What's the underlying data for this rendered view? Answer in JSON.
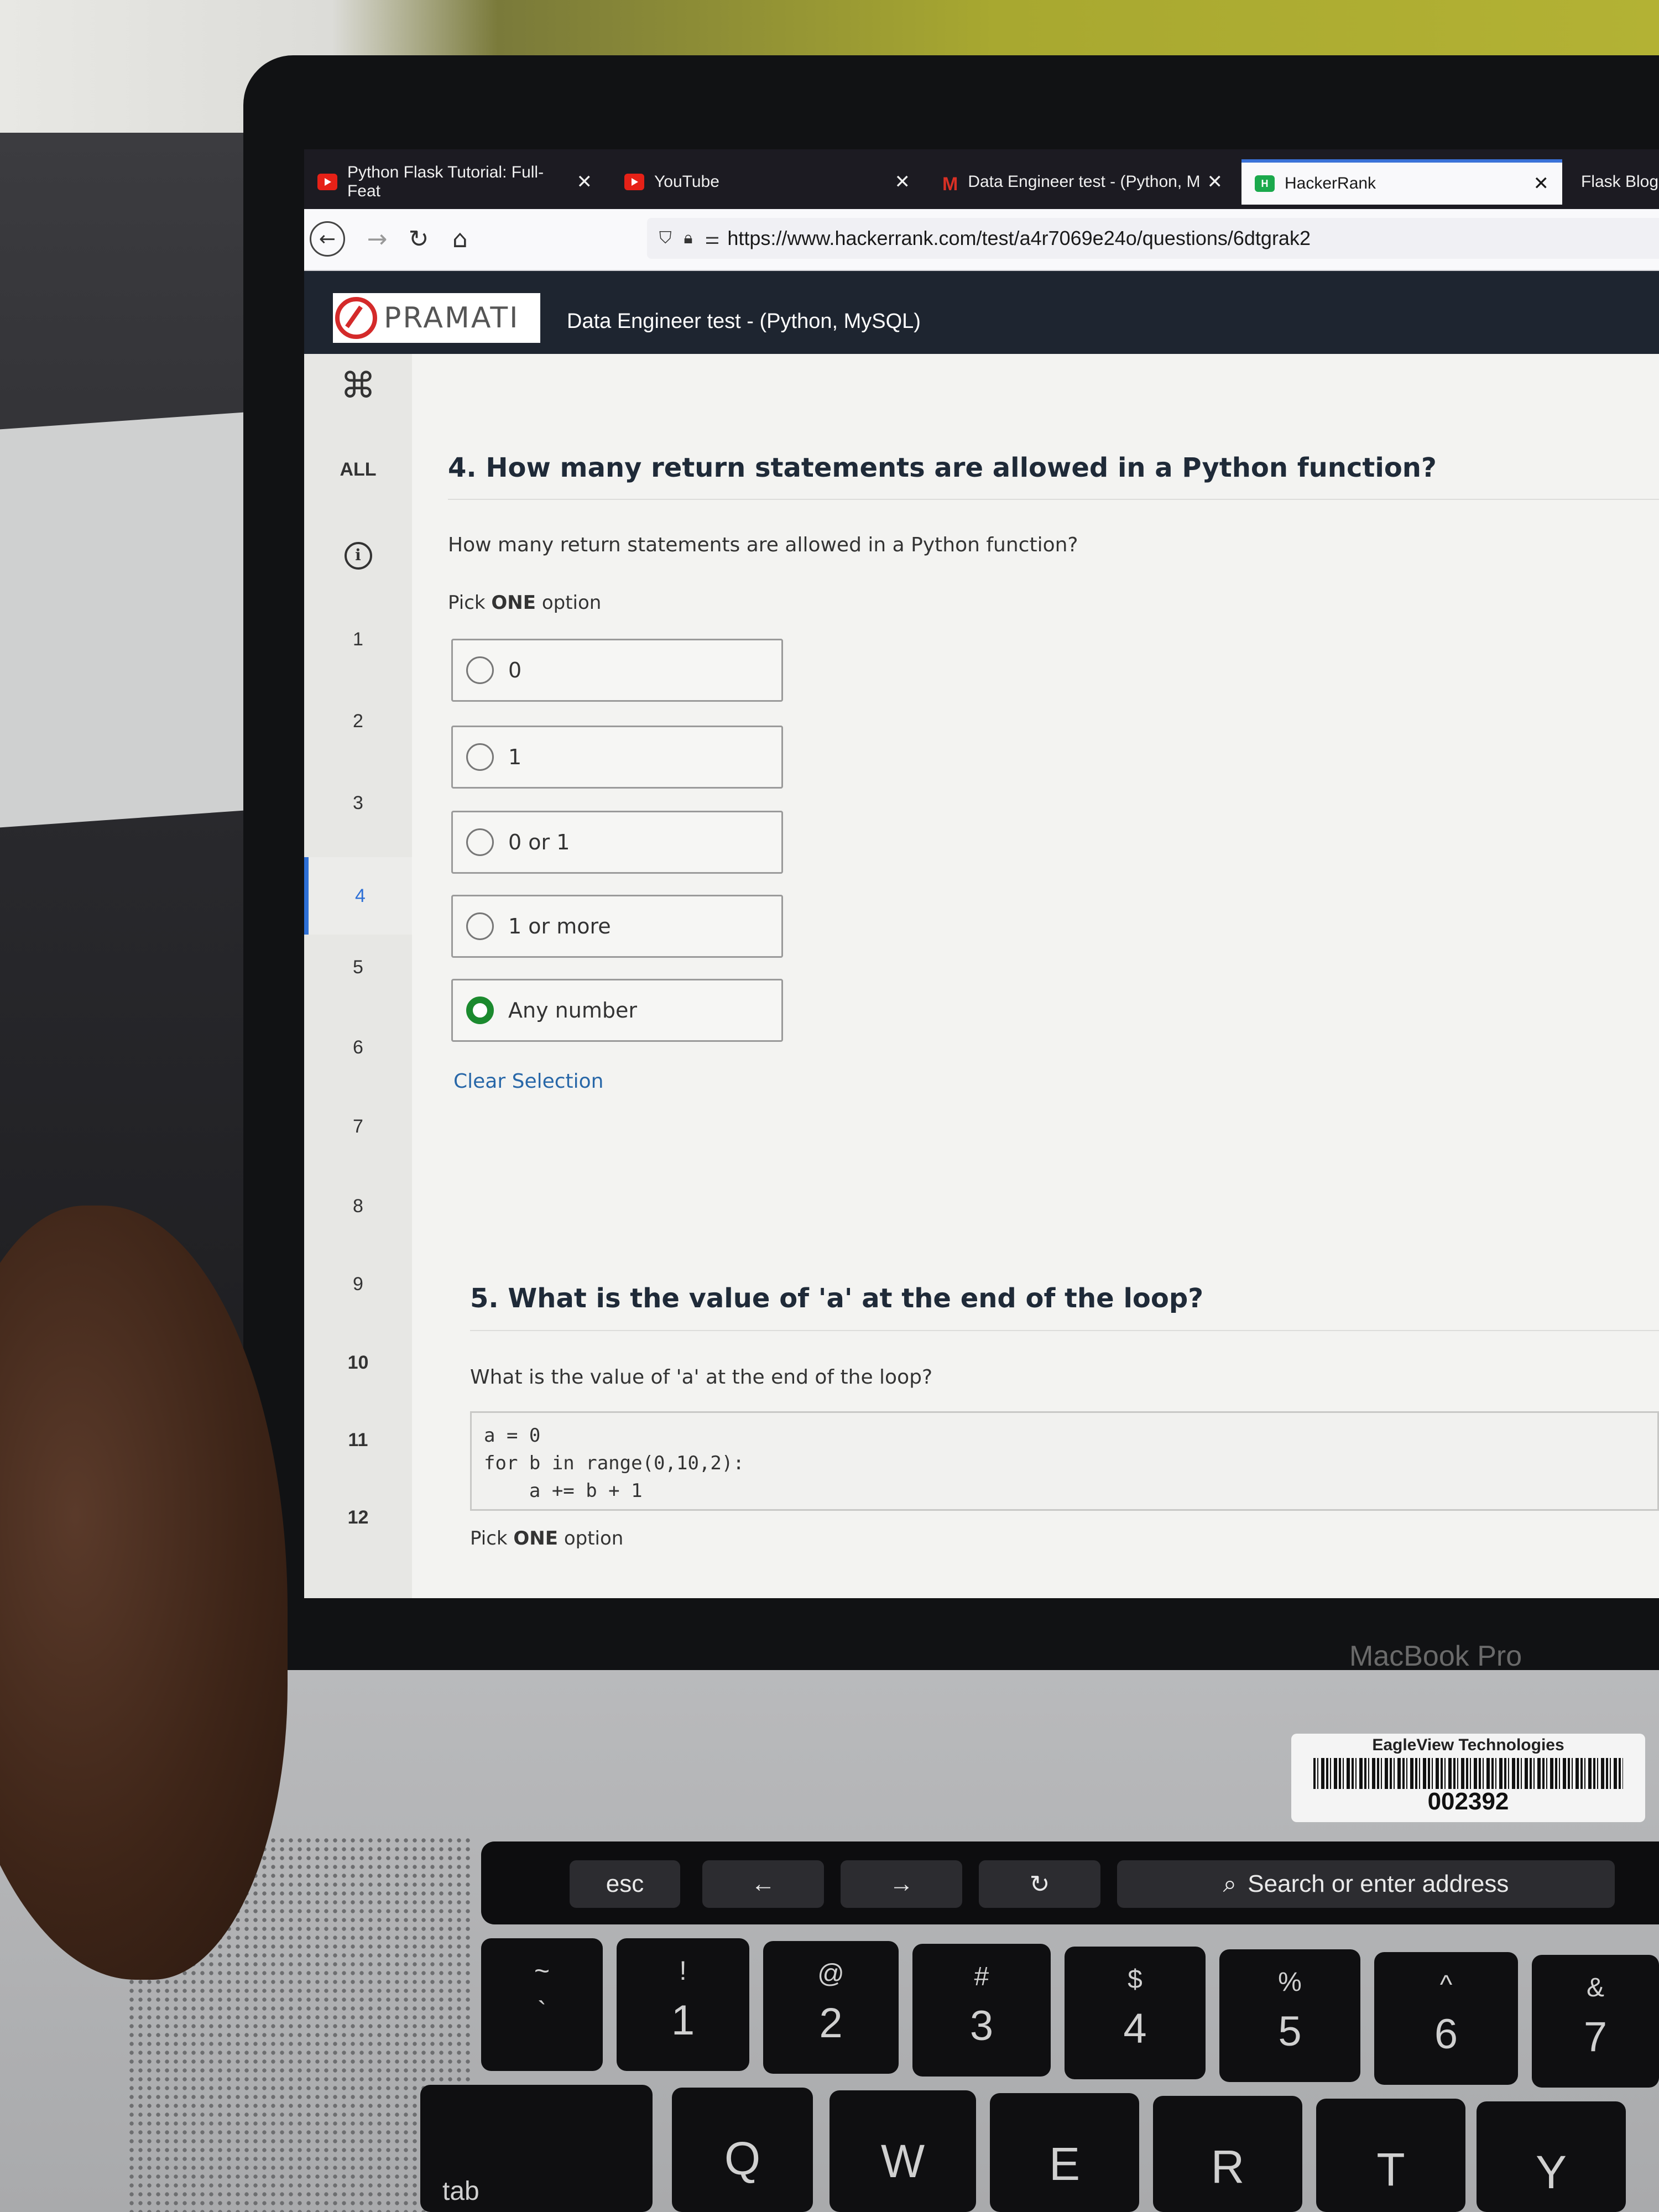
{
  "browser": {
    "tabs": [
      {
        "label": "Python Flask Tutorial: Full-Feat",
        "favicon": "youtube-icon",
        "active": false
      },
      {
        "label": "YouTube",
        "favicon": "youtube-icon",
        "active": false
      },
      {
        "label": "Data Engineer test - (Python, M",
        "favicon": "gmail-icon",
        "active": false
      },
      {
        "label": "HackerRank",
        "favicon": "hackerrank-icon",
        "active": true
      },
      {
        "label": "Flask Blog",
        "favicon": "",
        "active": false
      }
    ],
    "close_glyph": "✕",
    "url": "https://www.hackerrank.com/test/a4r7069e24o/questions/6dtgrak2"
  },
  "header": {
    "logo_text": "PRAMATI",
    "title": "Data Engineer test - (Python, MySQL)"
  },
  "sidebar": {
    "all_label": "ALL",
    "items": [
      "1",
      "2",
      "3",
      "4",
      "5",
      "6",
      "7",
      "8",
      "9",
      "10",
      "11",
      "12"
    ],
    "active_item": "4"
  },
  "question4": {
    "title": "4. How many return statements are allowed in a Python function?",
    "text": "How many return statements are allowed in a Python function?",
    "pick_prefix": "Pick",
    "pick_bold": "ONE",
    "pick_suffix": "option",
    "options": [
      "0",
      "1",
      "0 or 1",
      "1 or more",
      "Any number"
    ],
    "selected": "Any number",
    "clear_label": "Clear Selection"
  },
  "question5": {
    "title": "5. What is the value of 'a' at the end of the loop?",
    "text": "What is the value of 'a' at the end of the loop?",
    "code": "a = 0\nfor b in range(0,10,2):\n    a += b + 1",
    "pick_prefix": "Pick",
    "pick_bold": "ONE",
    "pick_suffix": "option"
  },
  "device": {
    "model_label": "MacBook Pro",
    "sticker_org": "EagleView Technologies",
    "sticker_number": "002392"
  },
  "touchbar": {
    "esc": "esc",
    "back": "←",
    "forward": "→",
    "reload": "↻",
    "search": "Search or enter address"
  },
  "keyboard": {
    "number_row": [
      {
        "top": "~",
        "bot": "`"
      },
      {
        "top": "!",
        "bot": "1"
      },
      {
        "top": "@",
        "bot": "2"
      },
      {
        "top": "#",
        "bot": "3"
      },
      {
        "top": "$",
        "bot": "4"
      },
      {
        "top": "%",
        "bot": "5"
      },
      {
        "top": "^",
        "bot": "6"
      },
      {
        "top": "&",
        "bot": "7"
      }
    ],
    "letter_row": [
      "tab",
      "Q",
      "W",
      "E",
      "R",
      "T",
      "Y"
    ]
  }
}
